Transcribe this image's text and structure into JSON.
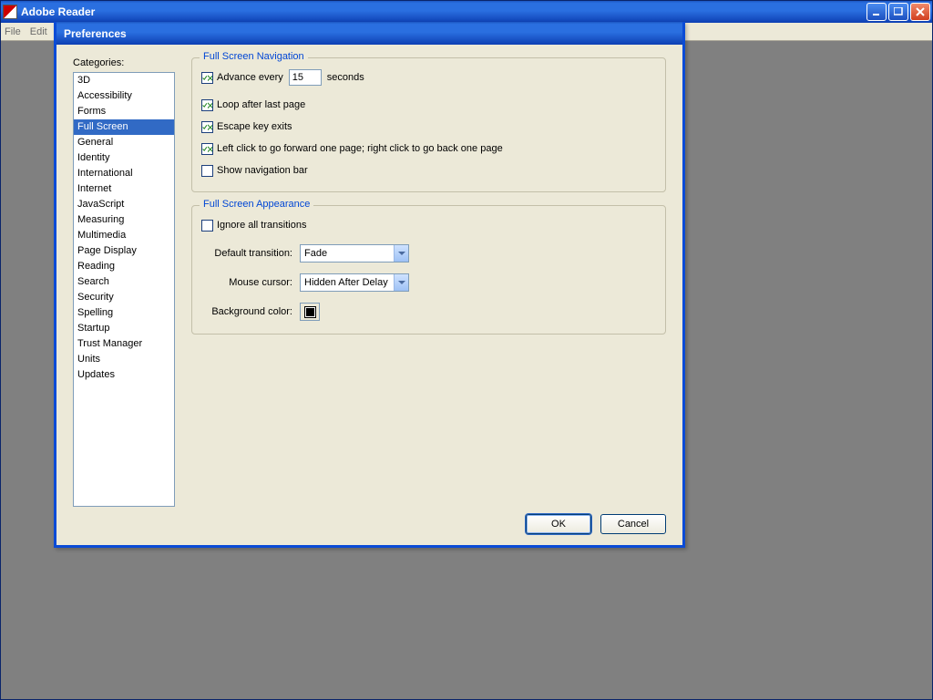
{
  "app": {
    "title": "Adobe Reader",
    "menubar": [
      "File",
      "Edit"
    ]
  },
  "dialog": {
    "title": "Preferences",
    "categories_label": "Categories:",
    "categories": [
      "3D",
      "Accessibility",
      "Forms",
      "Full Screen",
      "General",
      "Identity",
      "International",
      "Internet",
      "JavaScript",
      "Measuring",
      "Multimedia",
      "Page Display",
      "Reading",
      "Search",
      "Security",
      "Spelling",
      "Startup",
      "Trust Manager",
      "Units",
      "Updates"
    ],
    "selected_category_index": 3,
    "nav_group": {
      "legend": "Full Screen Navigation",
      "advance_every_label": "Advance every",
      "advance_every_value": "15",
      "seconds_label": "seconds",
      "advance_every_checked": true,
      "loop_label": "Loop after last page",
      "loop_checked": true,
      "escape_label": "Escape key exits",
      "escape_checked": true,
      "click_label": "Left click to go forward one page; right click to go back one page",
      "click_checked": true,
      "navbar_label": "Show navigation bar",
      "navbar_checked": false
    },
    "appearance_group": {
      "legend": "Full Screen Appearance",
      "ignore_label": "Ignore all transitions",
      "ignore_checked": false,
      "transition_label": "Default transition:",
      "transition_value": "Fade",
      "cursor_label": "Mouse cursor:",
      "cursor_value": "Hidden After Delay",
      "bgcolor_label": "Background color:",
      "bgcolor_value": "#000000"
    },
    "buttons": {
      "ok": "OK",
      "cancel": "Cancel"
    }
  }
}
